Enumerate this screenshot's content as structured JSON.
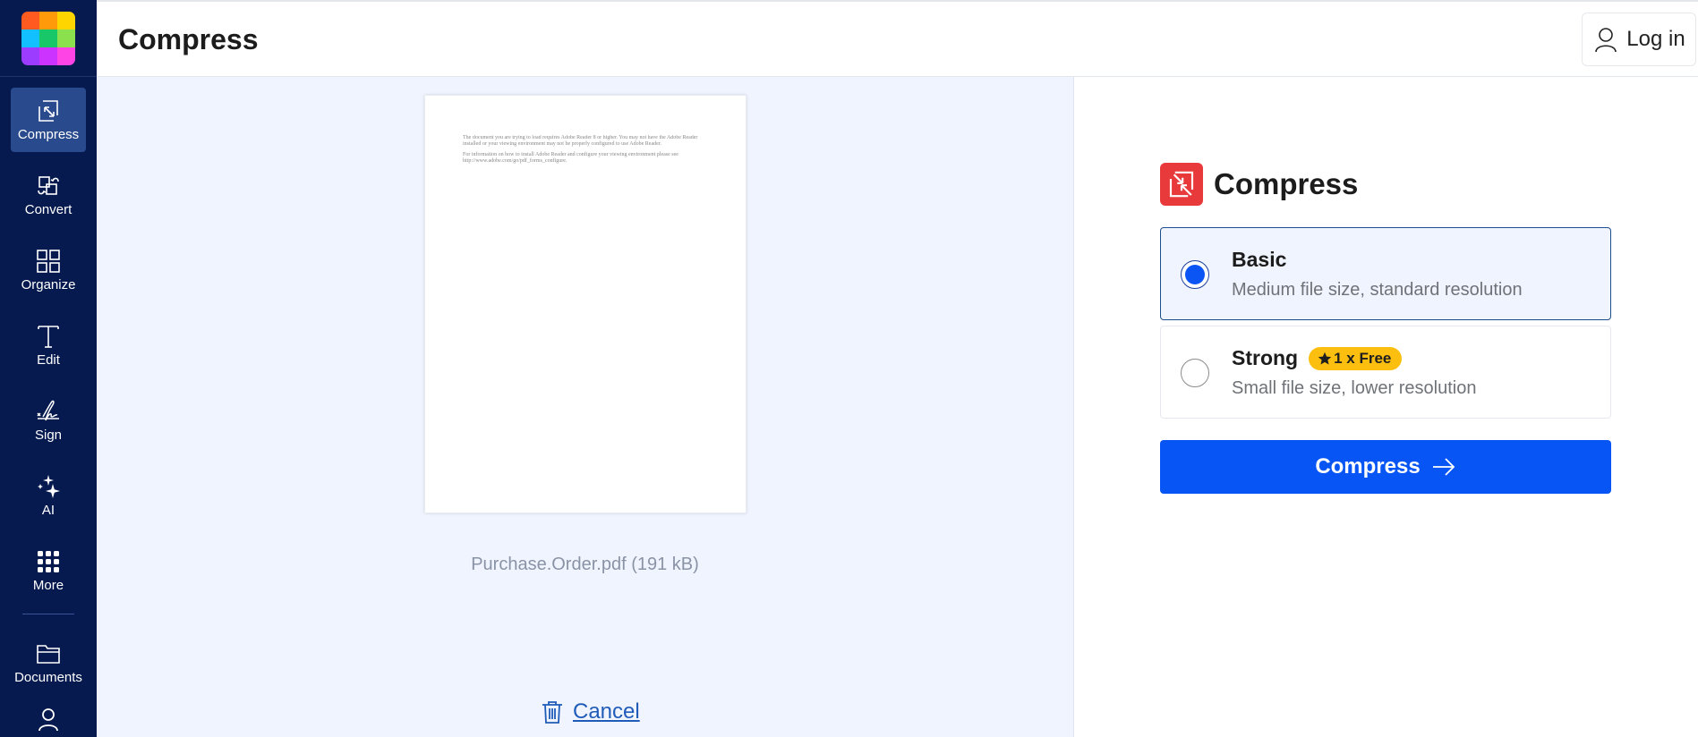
{
  "sidebar": {
    "logo_colors": [
      "#ff5a1f",
      "#ff9a0a",
      "#ffd500",
      "#12c0ff",
      "#18c767",
      "#8be04e",
      "#9b3cff",
      "#cc33ff",
      "#ff44e6"
    ],
    "items": [
      {
        "label": "Compress",
        "icon": "compress-icon",
        "active": true
      },
      {
        "label": "Convert",
        "icon": "convert-icon",
        "active": false
      },
      {
        "label": "Organize",
        "icon": "organize-icon",
        "active": false
      },
      {
        "label": "Edit",
        "icon": "edit-icon",
        "active": false
      },
      {
        "label": "Sign",
        "icon": "sign-icon",
        "active": false
      },
      {
        "label": "AI",
        "icon": "ai-sparkle-icon",
        "active": false
      },
      {
        "label": "More",
        "icon": "grid-dots-icon",
        "active": false
      }
    ],
    "bottom_items": [
      {
        "label": "Documents",
        "icon": "folder-icon"
      },
      {
        "label": "",
        "icon": "user-icon"
      }
    ]
  },
  "header": {
    "title": "Compress",
    "login_label": "Log in"
  },
  "preview": {
    "document_text": [
      "The document you are trying to load requires Adobe Reader 8 or higher. You may not have the Adobe Reader installed or your viewing environment may not be properly configured to use Adobe Reader.",
      "For information on how to install Adobe Reader and configure your viewing environment please see http://www.adobe.com/go/pdf_forms_configure."
    ],
    "file_name": "Purchase.Order.pdf (191 kB)",
    "cancel_label": "Cancel"
  },
  "panel": {
    "title": "Compress",
    "options": [
      {
        "title": "Basic",
        "description": "Medium file size, standard resolution",
        "selected": true,
        "badge": ""
      },
      {
        "title": "Strong",
        "description": "Small file size, lower resolution",
        "selected": false,
        "badge": "1 x Free"
      }
    ],
    "submit_label": "Compress"
  },
  "colors": {
    "sidebar_bg": "#061a4f",
    "accent_blue": "#0755f5",
    "tool_red": "#e83a3a",
    "badge_yellow": "#fcbf0f"
  }
}
